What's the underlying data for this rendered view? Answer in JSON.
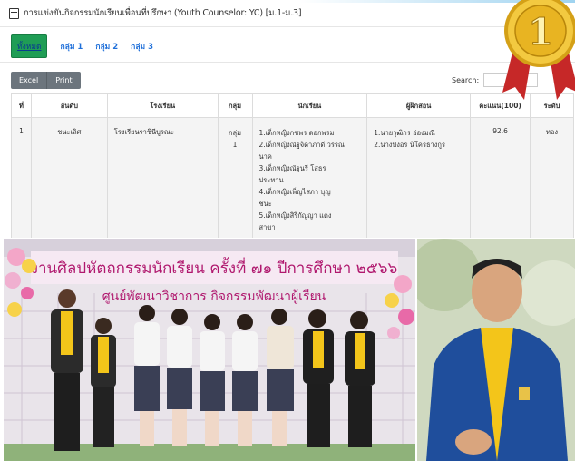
{
  "page": {
    "title": "การแข่งขันกิจกรรมนักเรียนเพื่อนที่ปรึกษา (Youth Counselor: YC) [ม.1-ม.3]"
  },
  "tabs": [
    {
      "label": "ทั้งหมด",
      "active": true
    },
    {
      "label": "กลุ่ม 1",
      "active": false
    },
    {
      "label": "กลุ่ม 2",
      "active": false
    },
    {
      "label": "กลุ่ม 3",
      "active": false
    }
  ],
  "toolbar": {
    "excel_label": "Excel",
    "print_label": "Print",
    "search_label": "Search:",
    "search_value": ""
  },
  "table": {
    "headers": [
      "ที่",
      "อันดับ",
      "โรงเรียน",
      "กลุ่ม",
      "นักเรียน",
      "ผู้ฝึกสอน",
      "คะแนน(100)",
      "ระดับ"
    ],
    "rows": [
      {
        "no": "1",
        "rank": "ชนะเลิศ",
        "school": "โรงเรียนราชินีบูรณะ",
        "group_line1": "กลุ่ม",
        "group_line2": "1",
        "students": [
          "1.เด็กหญิงกชพร ดอกพรม",
          "2.เด็กหญิงณัฐจิดาภาดี วรรณ",
          "นาค",
          "3.เด็กหญิงณัฐนรี โสธร",
          "ประทาน",
          "4.เด็กหญิงเพ็ญไสภา บุญ",
          "ชนะ",
          "5.เด็กหญิงสิริกัญญา แดง",
          "สาขา"
        ],
        "trainers": [
          "1.นายวุฒิกร อ่องมณี",
          "2.นางบังอร นิโครธางกูร"
        ],
        "score": "92.6",
        "level": "ทอง"
      }
    ]
  },
  "medal": {
    "number": "1",
    "colors": {
      "gold": "#e6b422",
      "ribbon": "#d32f2f"
    }
  },
  "banner": {
    "line1": "งานศิลปหัตถกรรมนักเรียน ครั้งที่ ๗๑ ปีการศึกษา ๒๕๖๖",
    "line2": "ศูนย์พัฒนาวิชาการ กิจกรรมพัฒนาผู้เรียน"
  },
  "colors": {
    "active_tab": "#1f9d55",
    "link": "#1e6fd9",
    "button": "#6c757d"
  }
}
